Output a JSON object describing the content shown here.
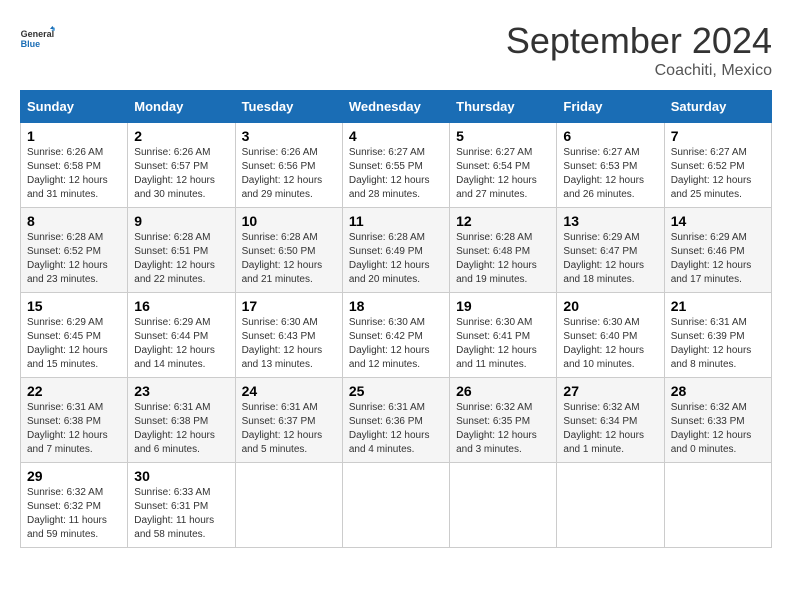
{
  "logo": {
    "line1": "General",
    "line2": "Blue"
  },
  "title": "September 2024",
  "location": "Coachiti, Mexico",
  "days_of_week": [
    "Sunday",
    "Monday",
    "Tuesday",
    "Wednesday",
    "Thursday",
    "Friday",
    "Saturday"
  ],
  "weeks": [
    [
      {
        "day": "1",
        "sunrise": "6:26 AM",
        "sunset": "6:58 PM",
        "daylight": "12 hours and 31 minutes."
      },
      {
        "day": "2",
        "sunrise": "6:26 AM",
        "sunset": "6:57 PM",
        "daylight": "12 hours and 30 minutes."
      },
      {
        "day": "3",
        "sunrise": "6:26 AM",
        "sunset": "6:56 PM",
        "daylight": "12 hours and 29 minutes."
      },
      {
        "day": "4",
        "sunrise": "6:27 AM",
        "sunset": "6:55 PM",
        "daylight": "12 hours and 28 minutes."
      },
      {
        "day": "5",
        "sunrise": "6:27 AM",
        "sunset": "6:54 PM",
        "daylight": "12 hours and 27 minutes."
      },
      {
        "day": "6",
        "sunrise": "6:27 AM",
        "sunset": "6:53 PM",
        "daylight": "12 hours and 26 minutes."
      },
      {
        "day": "7",
        "sunrise": "6:27 AM",
        "sunset": "6:52 PM",
        "daylight": "12 hours and 25 minutes."
      }
    ],
    [
      {
        "day": "8",
        "sunrise": "6:28 AM",
        "sunset": "6:52 PM",
        "daylight": "12 hours and 23 minutes."
      },
      {
        "day": "9",
        "sunrise": "6:28 AM",
        "sunset": "6:51 PM",
        "daylight": "12 hours and 22 minutes."
      },
      {
        "day": "10",
        "sunrise": "6:28 AM",
        "sunset": "6:50 PM",
        "daylight": "12 hours and 21 minutes."
      },
      {
        "day": "11",
        "sunrise": "6:28 AM",
        "sunset": "6:49 PM",
        "daylight": "12 hours and 20 minutes."
      },
      {
        "day": "12",
        "sunrise": "6:28 AM",
        "sunset": "6:48 PM",
        "daylight": "12 hours and 19 minutes."
      },
      {
        "day": "13",
        "sunrise": "6:29 AM",
        "sunset": "6:47 PM",
        "daylight": "12 hours and 18 minutes."
      },
      {
        "day": "14",
        "sunrise": "6:29 AM",
        "sunset": "6:46 PM",
        "daylight": "12 hours and 17 minutes."
      }
    ],
    [
      {
        "day": "15",
        "sunrise": "6:29 AM",
        "sunset": "6:45 PM",
        "daylight": "12 hours and 15 minutes."
      },
      {
        "day": "16",
        "sunrise": "6:29 AM",
        "sunset": "6:44 PM",
        "daylight": "12 hours and 14 minutes."
      },
      {
        "day": "17",
        "sunrise": "6:30 AM",
        "sunset": "6:43 PM",
        "daylight": "12 hours and 13 minutes."
      },
      {
        "day": "18",
        "sunrise": "6:30 AM",
        "sunset": "6:42 PM",
        "daylight": "12 hours and 12 minutes."
      },
      {
        "day": "19",
        "sunrise": "6:30 AM",
        "sunset": "6:41 PM",
        "daylight": "12 hours and 11 minutes."
      },
      {
        "day": "20",
        "sunrise": "6:30 AM",
        "sunset": "6:40 PM",
        "daylight": "12 hours and 10 minutes."
      },
      {
        "day": "21",
        "sunrise": "6:31 AM",
        "sunset": "6:39 PM",
        "daylight": "12 hours and 8 minutes."
      }
    ],
    [
      {
        "day": "22",
        "sunrise": "6:31 AM",
        "sunset": "6:38 PM",
        "daylight": "12 hours and 7 minutes."
      },
      {
        "day": "23",
        "sunrise": "6:31 AM",
        "sunset": "6:38 PM",
        "daylight": "12 hours and 6 minutes."
      },
      {
        "day": "24",
        "sunrise": "6:31 AM",
        "sunset": "6:37 PM",
        "daylight": "12 hours and 5 minutes."
      },
      {
        "day": "25",
        "sunrise": "6:31 AM",
        "sunset": "6:36 PM",
        "daylight": "12 hours and 4 minutes."
      },
      {
        "day": "26",
        "sunrise": "6:32 AM",
        "sunset": "6:35 PM",
        "daylight": "12 hours and 3 minutes."
      },
      {
        "day": "27",
        "sunrise": "6:32 AM",
        "sunset": "6:34 PM",
        "daylight": "12 hours and 1 minute."
      },
      {
        "day": "28",
        "sunrise": "6:32 AM",
        "sunset": "6:33 PM",
        "daylight": "12 hours and 0 minutes."
      }
    ],
    [
      {
        "day": "29",
        "sunrise": "6:32 AM",
        "sunset": "6:32 PM",
        "daylight": "11 hours and 59 minutes."
      },
      {
        "day": "30",
        "sunrise": "6:33 AM",
        "sunset": "6:31 PM",
        "daylight": "11 hours and 58 minutes."
      },
      null,
      null,
      null,
      null,
      null
    ]
  ],
  "labels": {
    "sunrise": "Sunrise: ",
    "sunset": "Sunset: ",
    "daylight": "Daylight: "
  }
}
